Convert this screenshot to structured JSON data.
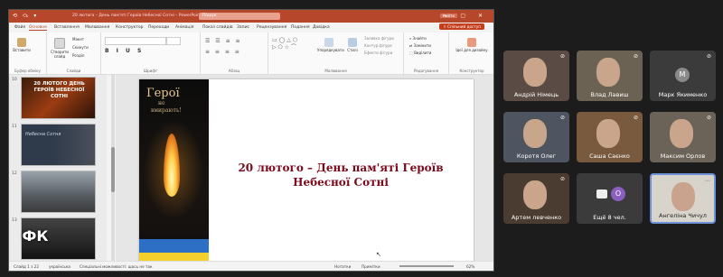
{
  "titlebar": {
    "doc_title": "20 лютого – День пам'яті Героїв Небесної Сотні – PowerPoint",
    "search_placeholder": "Пошук",
    "badge": "Увійти",
    "window_controls": "— ▢ ✕",
    "qat": "⟲ ⤼ ▾"
  },
  "ribbon_tabs": [
    "Файл",
    "Основне",
    "Вставлення",
    "Малювання",
    "Конструктор",
    "Переходи",
    "Анімація",
    "Показ слайдів",
    "Запис",
    "Рецензування",
    "Подання",
    "Довідка"
  ],
  "share_button": "⇪ Спільний доступ",
  "ribbon_groups": {
    "clipboard": "Буфер обміну",
    "slides": "Слайди",
    "font": "Шрифт",
    "paragraph": "Абзац",
    "drawing": "Малювання",
    "editing": "Редагування",
    "designer": "Конструктор"
  },
  "ribbon_buttons": {
    "paste": "Вставити",
    "new_slide": "Створити слайд",
    "layout": "Макет",
    "reset": "Скинути",
    "section": "Розділ",
    "shapes": "Фігури",
    "arrange": "Упорядкувати",
    "quick_styles": "Стилі",
    "find": "Знайти",
    "replace": "Замінити",
    "select": "Виділити",
    "shape_fill": "Заливка фігури",
    "shape_outline": "Контур фігури",
    "shape_effects": "Ефекти фігури",
    "designer_ideas": "Ідеї для дизайну"
  },
  "thumbnails": [
    {
      "number": "10",
      "text": "20 ЛЮТОГО ДЕНЬ ГЕРОЇВ НЕБЕСНОЇ СОТНІ"
    },
    {
      "number": "11",
      "text": "Небесна Сотня"
    },
    {
      "number": "12",
      "text": ""
    },
    {
      "number": "13",
      "text": ""
    }
  ],
  "slide": {
    "candle_heading": "Герої",
    "candle_sub1": "не",
    "candle_sub2": "вмирають!",
    "title": "20 лютого – День пам'яті Героїв Небесної Сотні"
  },
  "status_bar": {
    "slide_info": "Слайд 1 з 22",
    "language": "українська",
    "accessibility": "Спеціальні можливості: щось не так",
    "notes": "Нотатки",
    "comments": "Примітки",
    "zoom": "62%"
  },
  "participants": [
    {
      "name": "Андрій Німець",
      "muted": true,
      "video": true
    },
    {
      "name": "Влад Лавиш",
      "muted": true,
      "video": true
    },
    {
      "name": "Марк Якименко",
      "muted": true,
      "video": false,
      "initial": "M"
    },
    {
      "name": "Коротя Олег",
      "muted": true,
      "video": true
    },
    {
      "name": "Саша Саєнко",
      "muted": true,
      "video": true
    },
    {
      "name": "Максим Орлов",
      "muted": true,
      "video": true
    },
    {
      "name": "Артем левченко",
      "muted": true,
      "video": true
    },
    {
      "name": "Ещё 8 чел.",
      "muted": false,
      "video": false,
      "initial": "O"
    },
    {
      "name": "Ангеліна Чичул",
      "muted": true,
      "video": true
    }
  ],
  "logo_text": "ФК"
}
